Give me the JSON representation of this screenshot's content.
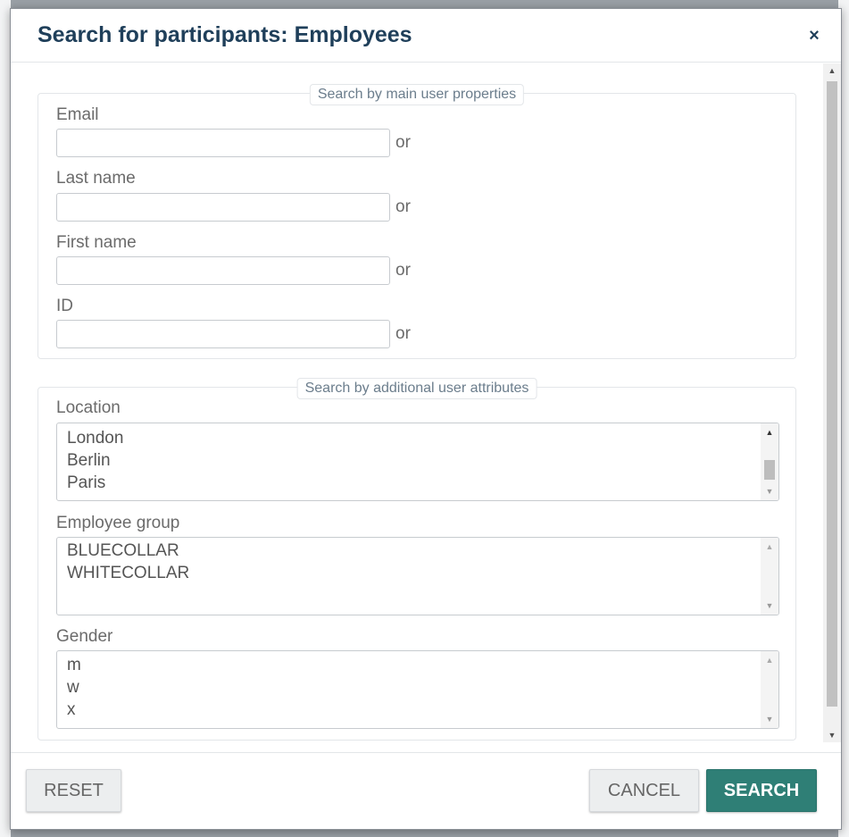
{
  "dialog": {
    "title": "Search for participants: Employees",
    "close_icon": "×"
  },
  "main_properties": {
    "legend": "Search by main user properties",
    "fields": [
      {
        "label": "Email",
        "value": "",
        "suffix": "or"
      },
      {
        "label": "Last name",
        "value": "",
        "suffix": "or"
      },
      {
        "label": "First name",
        "value": "",
        "suffix": "or"
      },
      {
        "label": "ID",
        "value": "",
        "suffix": "or"
      }
    ]
  },
  "additional_attributes": {
    "legend": "Search by additional user attributes",
    "location": {
      "label": "Location",
      "options": [
        "London",
        "Berlin",
        "Paris"
      ]
    },
    "employee_group": {
      "label": "Employee group",
      "options": [
        "BLUECOLLAR",
        "WHITECOLLAR"
      ]
    },
    "gender": {
      "label": "Gender",
      "options": [
        "m",
        "w",
        "x"
      ]
    }
  },
  "icons": {
    "scroll_up": "▲",
    "scroll_down": "▼"
  },
  "colors": {
    "title": "#1f3f5a",
    "primary_button": "#2f7f76"
  },
  "footer": {
    "reset_label": "RESET",
    "cancel_label": "CANCEL",
    "search_label": "SEARCH"
  }
}
